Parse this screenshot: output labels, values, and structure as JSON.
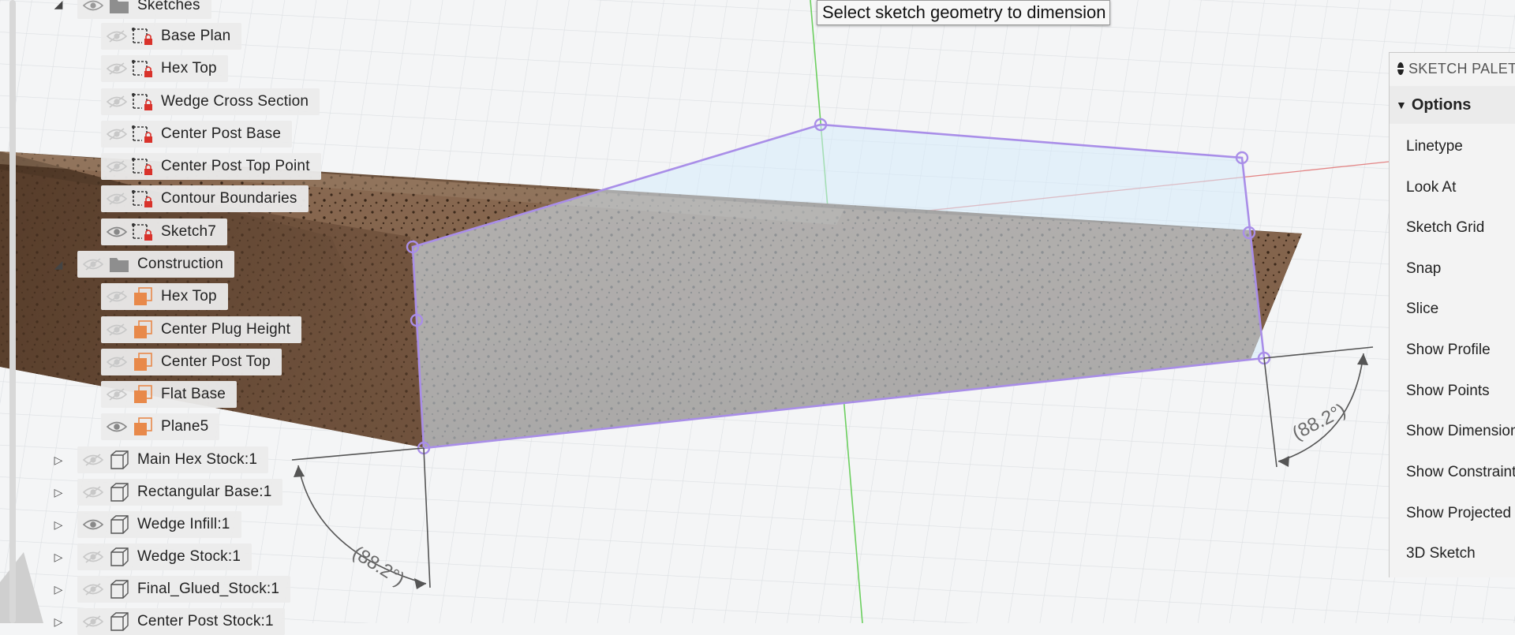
{
  "tooltip": {
    "text": "Select sketch geometry to dimension"
  },
  "browser_tree": {
    "sketches_folder": {
      "label": "Sketches"
    },
    "sketches": [
      {
        "label": "Base Plan",
        "visible": false
      },
      {
        "label": "Hex Top",
        "visible": false
      },
      {
        "label": "Wedge Cross Section",
        "visible": false
      },
      {
        "label": "Center Post Base",
        "visible": false
      },
      {
        "label": "Center Post Top Point",
        "visible": false
      },
      {
        "label": "Contour Boundaries",
        "visible": false
      },
      {
        "label": "Sketch7",
        "visible": true
      }
    ],
    "construction_folder": {
      "label": "Construction"
    },
    "construction": [
      {
        "label": "Hex Top",
        "visible": false
      },
      {
        "label": "Center Plug Height",
        "visible": false
      },
      {
        "label": "Center Post Top",
        "visible": false
      },
      {
        "label": "Flat Base",
        "visible": false
      },
      {
        "label": "Plane5",
        "visible": true
      }
    ],
    "bodies": [
      {
        "label": "Main Hex Stock:1",
        "visible": false
      },
      {
        "label": "Rectangular Base:1",
        "visible": false
      },
      {
        "label": "Wedge Infill:1",
        "visible": true
      },
      {
        "label": "Wedge Stock:1",
        "visible": false
      },
      {
        "label": "Final_Glued_Stock:1",
        "visible": false
      },
      {
        "label": "Center Post Stock:1",
        "visible": false
      }
    ]
  },
  "dimensions": {
    "angle_left": "(88.2°)",
    "angle_right": "(88.2°)"
  },
  "sketch_palette": {
    "title": "SKETCH PALETTE",
    "section": "Options",
    "items": [
      "Linetype",
      "Look At",
      "Sketch Grid",
      "Snap",
      "Slice",
      "Show Profile",
      "Show Points",
      "Show Dimensions",
      "Show Constraints",
      "Show Projected",
      "3D Sketch"
    ]
  },
  "colors": {
    "sketch_profile": "#a98ee8",
    "profile_fill": "#d6ebfb",
    "x_axis": "#e06a6a",
    "y_axis": "#6ccf5f",
    "sketch_icon_lock": "#d9322b",
    "plane_icon": "#e8894a"
  }
}
